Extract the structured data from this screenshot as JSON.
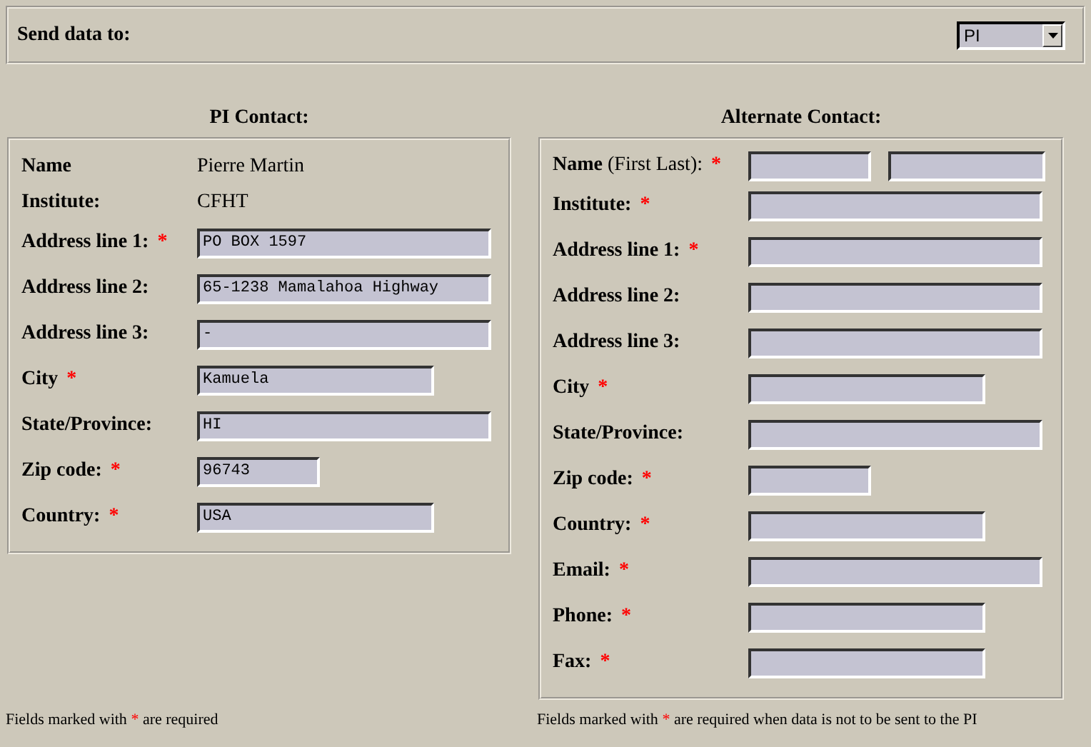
{
  "send_to": {
    "label": "Send data to:",
    "value": "PI"
  },
  "pi_contact": {
    "title": "PI Contact:",
    "rows": [
      {
        "label": "Name",
        "kind": "text",
        "value": "Pierre Martin"
      },
      {
        "label": "Institute:",
        "kind": "text",
        "value": "CFHT"
      },
      {
        "label": "Address line 1:",
        "mark": "*",
        "kind": "wide",
        "value": "PO BOX 1597"
      },
      {
        "label": "Address line 2:",
        "kind": "wide",
        "value": "65-1238 Mamalahoa Highway"
      },
      {
        "label": "Address line 3:",
        "kind": "wide",
        "value": "-"
      },
      {
        "label": "City",
        "mark": "*",
        "kind": "medium",
        "value": "Kamuela"
      },
      {
        "label": "State/Province:",
        "kind": "wide",
        "value": "HI"
      },
      {
        "label": "Zip code:",
        "mark": "*",
        "kind": "narrow",
        "value": "96743"
      },
      {
        "label": "Country:",
        "mark": "*",
        "kind": "medium",
        "value": "USA"
      }
    ]
  },
  "alternate_contact": {
    "title": "Alternate Contact:",
    "rows": [
      {
        "label": "Name",
        "hint": "(First Last):",
        "mark": "*",
        "kind": "name"
      },
      {
        "label": "Institute:",
        "mark": "*",
        "kind": "wide"
      },
      {
        "label": "Address line 1:",
        "mark": "*",
        "kind": "wide"
      },
      {
        "label": "Address line 2:",
        "kind": "wide"
      },
      {
        "label": "Address line 3:",
        "kind": "wide"
      },
      {
        "label": "City",
        "mark": "*",
        "kind": "medium"
      },
      {
        "label": "State/Province:",
        "kind": "wide"
      },
      {
        "label": "Zip code:",
        "mark": "*",
        "kind": "narrow"
      },
      {
        "label": "Country:",
        "mark": "*",
        "kind": "medium"
      },
      {
        "label": "Email:",
        "mark": "*",
        "kind": "wide"
      },
      {
        "label": "Phone:",
        "mark": "*",
        "kind": "medium"
      },
      {
        "label": "Fax:",
        "mark": "*",
        "kind": "medium"
      }
    ]
  },
  "footnotes": [
    {
      "before": "Fields marked with",
      "mark": "*",
      "after": "are required"
    },
    {
      "before": "Fields marked with",
      "mark": "*",
      "after": "are required when data is not to be sent to the PI"
    }
  ]
}
